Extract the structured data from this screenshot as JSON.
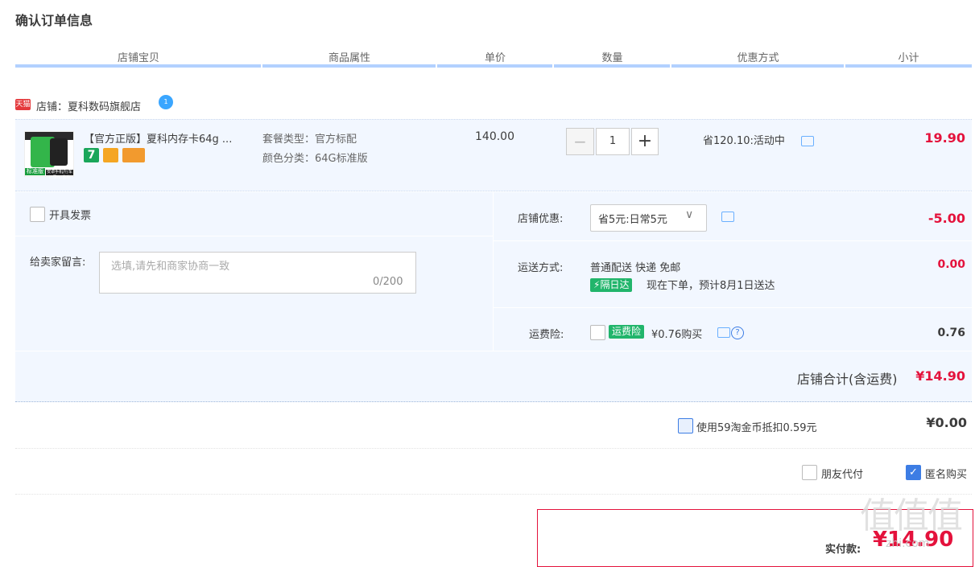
{
  "page": {
    "title": "确认订单信息"
  },
  "columns": [
    "店铺宝贝",
    "商品属性",
    "单价",
    "数量",
    "优惠方式",
    "小计"
  ],
  "shop": {
    "badge": "天猫",
    "label": "店铺：夏科数码旗舰店",
    "ww_badge": "1"
  },
  "item": {
    "name": "【官方正版】夏科内存卡64g ...",
    "attrs": [
      "套餐类型：官方标配",
      "颜色分类：64G标准版"
    ],
    "thumb_tags": [
      "标准版",
      "安卓手机/行车记录仪/监控"
    ],
    "price": "140.00",
    "qty": "1",
    "discount": "省120.10:活动中",
    "subtotal": "19.90"
  },
  "invoice": {
    "label": "开具发票"
  },
  "message": {
    "label": "给卖家留言:",
    "placeholder": "选填,请先和商家协商一致",
    "count": "0/200"
  },
  "shop_discount": {
    "label": "店铺优惠:",
    "selected": "省5元:日常5元",
    "value": "-5.00"
  },
  "shipping": {
    "label": "运送方式:",
    "method": "普通配送 快递 免邮",
    "badge": "隔日达",
    "eta": "现在下单，预计8月1日送达",
    "value": "0.00"
  },
  "insurance": {
    "label": "运费险:",
    "badge": "运费险",
    "price": "¥0.76购买",
    "value": "0.76"
  },
  "shop_total": {
    "label": "店铺合计(含运费)",
    "value": "¥14.90"
  },
  "coins": {
    "label": "使用59淘金币抵扣0.59元",
    "value": "¥0.00"
  },
  "options": {
    "friend_pay": "朋友代付",
    "anonymous": "匿名购买"
  },
  "pay": {
    "label": "实付款:",
    "value": "¥14.90"
  },
  "watermark": {
    "main": "值值值",
    "sub": "zhi.com"
  },
  "colors": {
    "accent_red": "#e4123c",
    "header_line": "#b2d1ff",
    "panel_bg": "#f2f7ff",
    "check_blue": "#3d7de4"
  }
}
